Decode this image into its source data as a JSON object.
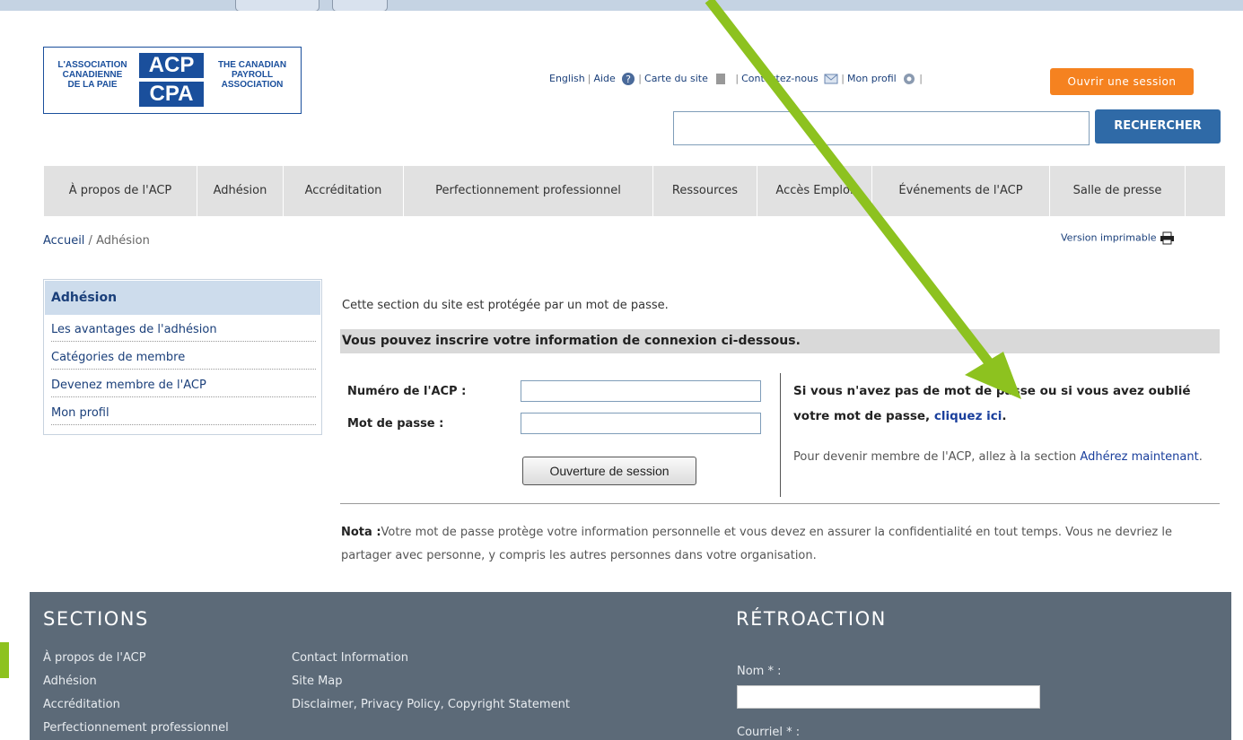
{
  "logo": {
    "left_text": [
      "L'ASSOCIATION",
      "CANADIENNE",
      "DE LA PAIE"
    ],
    "acp": "ACP",
    "cpa": "CPA",
    "right_text": [
      "THE CANADIAN",
      "PAYROLL",
      "ASSOCIATION"
    ]
  },
  "toplinks": {
    "english": "English",
    "aide": "Aide",
    "carte": "Carte du site",
    "contact": "Contactez-nous",
    "profil": "Mon profil"
  },
  "login_button": "Ouvrir une session",
  "search": {
    "button": "RECHERCHER",
    "value": ""
  },
  "nav": [
    "À propos de l'ACP",
    "Adhésion",
    "Accréditation",
    "Perfectionnement professionnel",
    "Ressources",
    "Accès Emploi",
    "Événements de l'ACP",
    "Salle de presse"
  ],
  "breadcrumb": {
    "home": "Accueil",
    "sep": " / ",
    "current": "Adhésion"
  },
  "print_version": "Version imprimable",
  "sidemenu": {
    "title": "Adhésion",
    "items": [
      "Les avantages de l'adhésion",
      "Catégories de membre",
      "Devenez membre de l'ACP",
      "Mon profil"
    ]
  },
  "main": {
    "protected": "Cette section du site est protégée par un mot de passe.",
    "subhead": "Vous pouvez inscrire votre information de connexion ci-dessous.",
    "acp_label": "Numéro de l'ACP :",
    "password_label": "Mot de passe :",
    "acp_value": "",
    "password_value": "",
    "session_button": "Ouverture de session",
    "forgot_text": "Si vous n'avez pas de mot de passe ou si vous avez oublié votre mot de passe,",
    "forgot_link": "cliquez ici",
    "forgot_end": ".",
    "join_text": "Pour devenir membre de l'ACP, allez à la section",
    "join_link": "Adhérez maintenant",
    "join_end": ".",
    "nota_label": "Nota :",
    "nota_text": "Votre mot de passe protège votre information personnelle et vous devez en assurer la confidentialité en tout temps. Vous ne devriez le partager avec personne, y compris les autres personnes dans votre organisation."
  },
  "footer": {
    "sections_title": "SECTIONS",
    "col1": [
      "À propos de l'ACP",
      "Adhésion",
      "Accréditation",
      "Perfectionnement professionnel"
    ],
    "col2": [
      "Contact Information",
      "Site Map",
      "Disclaimer, Privacy Policy, Copyright Statement"
    ],
    "retro_title": "RÉTROACTION",
    "nom_label": "Nom * :",
    "courriel_label": "Courriel * :"
  },
  "colors": {
    "accent": "#f58220",
    "brand": "#1a4f9c",
    "arrow": "#8dc21f",
    "footer": "#5c6a78"
  }
}
